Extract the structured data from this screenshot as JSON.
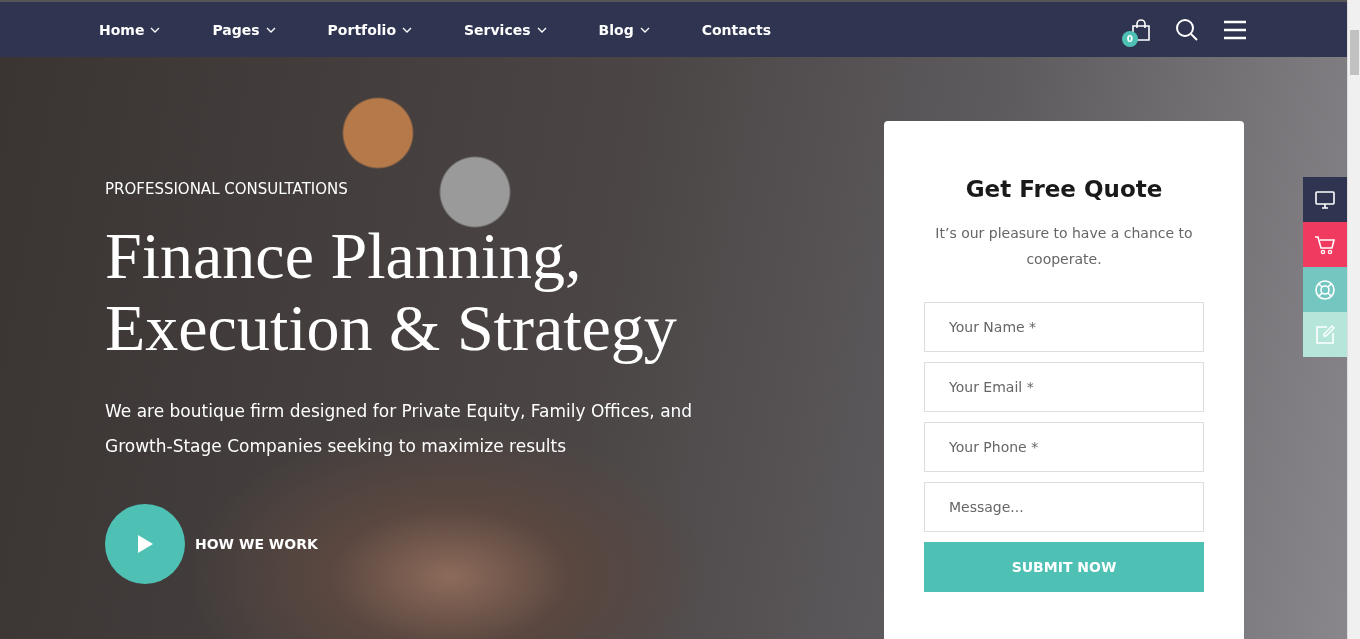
{
  "nav": {
    "items": [
      {
        "label": "Home",
        "has_dropdown": true
      },
      {
        "label": "Pages",
        "has_dropdown": true
      },
      {
        "label": "Portfolio",
        "has_dropdown": true
      },
      {
        "label": "Services",
        "has_dropdown": true
      },
      {
        "label": "Blog",
        "has_dropdown": true
      },
      {
        "label": "Contacts",
        "has_dropdown": false
      }
    ],
    "cart_count": "0"
  },
  "hero": {
    "eyebrow": "PROFESSIONAL CONSULTATIONS",
    "heading_lines": [
      "Finance Planning,",
      "Execution & Strategy"
    ],
    "description": "We are boutique firm designed for Private Equity, Family Offices, and Growth-Stage Companies seeking to maximize results",
    "video_label": "HOW WE WORK"
  },
  "quote_form": {
    "title": "Get Free Quote",
    "subtitle": "It’s our pleasure to have a chance to cooperate.",
    "fields": [
      {
        "placeholder": "Your Name *"
      },
      {
        "placeholder": "Your Email *"
      },
      {
        "placeholder": "Your Phone *"
      },
      {
        "placeholder": "Message..."
      }
    ],
    "submit": "SUBMIT NOW"
  },
  "side_widget": [
    {
      "kind": "monitor",
      "color": "#2f3550"
    },
    {
      "kind": "cart",
      "color": "#f03a5f"
    },
    {
      "kind": "lifebuoy",
      "color": "#74c7c0"
    },
    {
      "kind": "edit",
      "color": "#b5e6d9"
    }
  ]
}
